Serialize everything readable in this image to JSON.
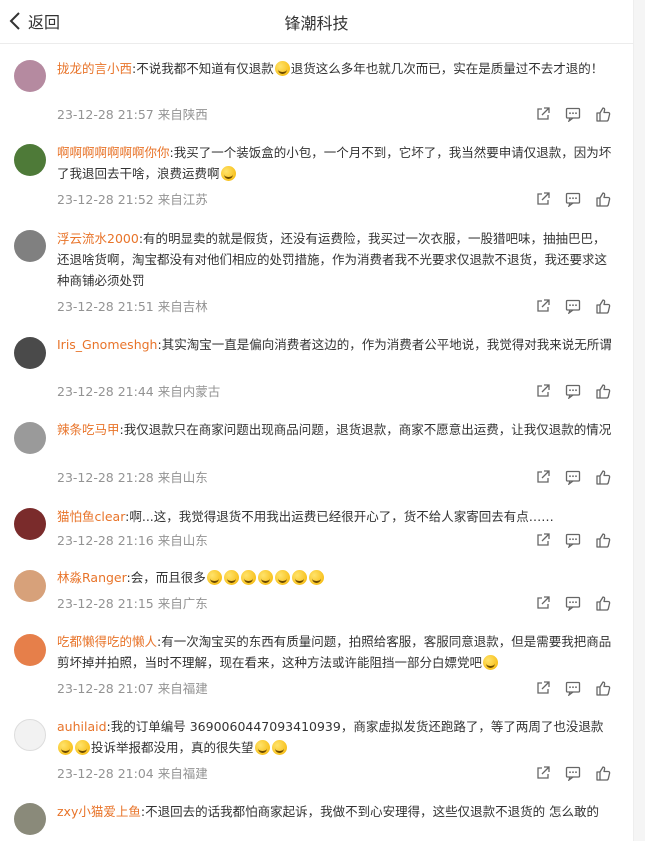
{
  "header": {
    "back_label": "返回",
    "title": "锋潮科技"
  },
  "comments": [
    {
      "username": "拢龙的言小西",
      "segments": [
        "不说我都不知道有仅退款",
        "退货这么多年也就几次而已，实在是质量过不去才退的！"
      ],
      "emojis": [
        "sob"
      ],
      "timestamp": "23-12-28 21:57",
      "location": "来自陕西"
    },
    {
      "username": "啊啊啊啊啊啊啊你你",
      "segments": [
        "我买了一个装饭盒的小包，一个月不到，它坏了，我当然要申请仅退款，因为坏了我退回去干啥，浪费运费啊",
        ""
      ],
      "emojis": [
        "smile"
      ],
      "timestamp": "23-12-28 21:52",
      "location": "来自江苏"
    },
    {
      "username": "浮云流水2000",
      "segments": [
        "有的明显卖的就是假货，还没有运费险，我买过一次衣服，一股猎吧味，抽抽巴巴，还退啥货啊，淘宝都没有对他们相应的处罚措施，作为消费者我不光要求仅退款不退货，我还要求这种商铺必须处罚"
      ],
      "emojis": [],
      "timestamp": "23-12-28 21:51",
      "location": "来自吉林"
    },
    {
      "username": "Iris_Gnomeshgh",
      "segments": [
        "其实淘宝一直是偏向消费者这边的，作为消费者公平地说，我觉得对我来说无所谓"
      ],
      "emojis": [],
      "timestamp": "23-12-28 21:44",
      "location": "来自内蒙古"
    },
    {
      "username": "辣条吃马甲",
      "segments": [
        "我仅退款只在商家问题出现商品问题，退货退款，商家不愿意出运费，让我仅退款的情况"
      ],
      "emojis": [],
      "timestamp": "23-12-28 21:28",
      "location": "来自山东"
    },
    {
      "username": "猫怕鱼clear",
      "segments": [
        "啊...这，我觉得退货不用我出运费已经很开心了，货不给人家寄回去有点……"
      ],
      "emojis": [],
      "timestamp": "23-12-28 21:16",
      "location": "来自山东"
    },
    {
      "username": "林淼Ranger",
      "segments": [
        "会，而且很多",
        "",
        "",
        "",
        "",
        "",
        ""
      ],
      "emojis": [
        "sob",
        "sob",
        "sob",
        "sob",
        "cry",
        "cry",
        "cry"
      ],
      "timestamp": "23-12-28 21:15",
      "location": "来自广东"
    },
    {
      "username": "吃都懒得吃的懒人",
      "segments": [
        "有一次淘宝买的东西有质量问题，拍照给客服，客服同意退款，但是需要我把商品剪坏掉并拍照，当时不理解，现在看来，这种方法或许能阻挡一部分白嫖党吧",
        ""
      ],
      "emojis": [
        "laugh"
      ],
      "timestamp": "23-12-28 21:07",
      "location": "来自福建"
    },
    {
      "username": "auhilaid",
      "segments": [
        "我的订单编号 3690060447093410939，商家虚拟发货还跑路了，等了两周了也没退款",
        "",
        "投诉举报都没用，真的很失望",
        "",
        ""
      ],
      "emojis": [
        "cry",
        "cry",
        "cry",
        "cry"
      ],
      "timestamp": "23-12-28 21:04",
      "location": "来自福建"
    },
    {
      "username": "zxy小猫爱上鱼",
      "segments": [
        "不退回去的话我都怕商家起诉，我做不到心安理得，这些仅退款不退货的 怎么敢的"
      ],
      "emojis": [],
      "timestamp": "",
      "location": ""
    }
  ],
  "colors": {
    "username": "#e8742a",
    "meta": "#939393",
    "text": "#333333"
  }
}
